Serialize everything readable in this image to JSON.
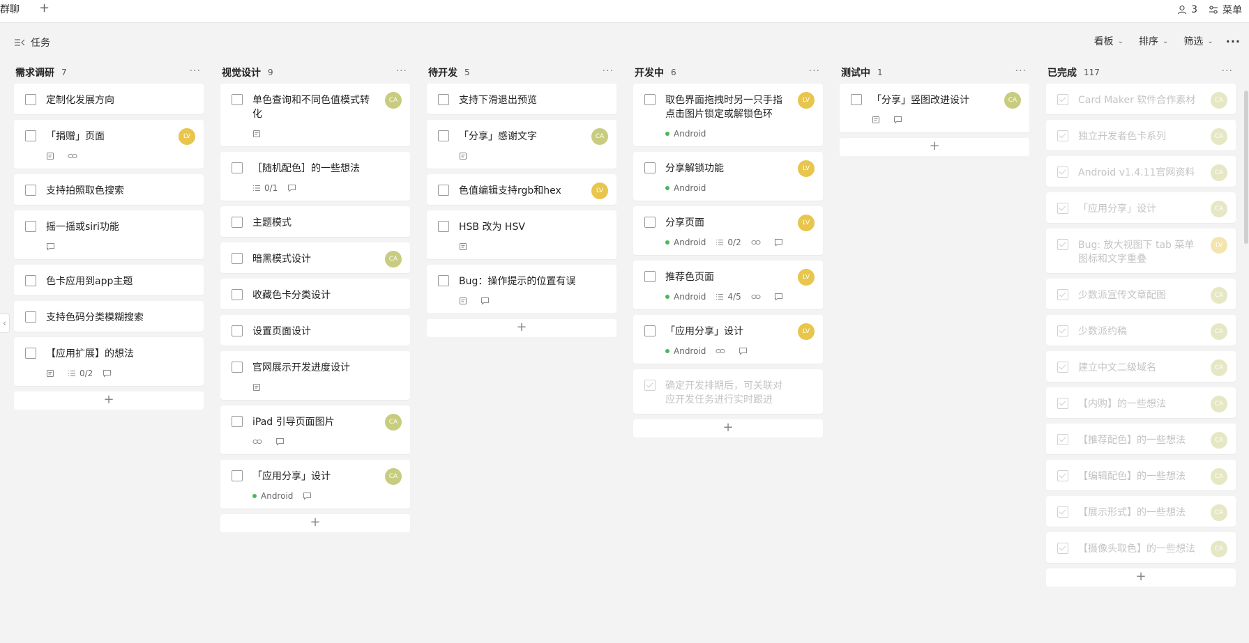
{
  "topbar": {
    "tab_title": "群聊",
    "add_tab": "+",
    "member_count": "3",
    "menu_label": "菜单"
  },
  "toolbar": {
    "title": "任务",
    "board": "看板",
    "sort": "排序",
    "filter": "筛选",
    "more": "···"
  },
  "columns": [
    {
      "title": "需求调研",
      "count": "7",
      "cards": [
        {
          "title": "定制化发展方向"
        },
        {
          "title": "「捐赠」页面",
          "avatar": "LV",
          "meta": [
            "doc",
            "link"
          ]
        },
        {
          "title": "支持拍照取色搜索"
        },
        {
          "title": "摇一摇或siri功能",
          "meta": [
            "comment"
          ]
        },
        {
          "title": "色卡应用到app主题"
        },
        {
          "title": "支持色码分类模糊搜索"
        },
        {
          "title": "【应用扩展】的想法",
          "checklist": "0/2",
          "meta": [
            "doc",
            "checklist",
            "comment"
          ]
        }
      ]
    },
    {
      "title": "视觉设计",
      "count": "9",
      "cards": [
        {
          "title": "单色查询和不同色值模式转化",
          "avatar": "CA",
          "meta": [
            "doc"
          ]
        },
        {
          "title": "［随机配色］的一些想法",
          "checklist": "0/1",
          "meta": [
            "checklist",
            "comment"
          ]
        },
        {
          "title": "主题模式"
        },
        {
          "title": "暗黑模式设计",
          "avatar": "CA"
        },
        {
          "title": "收藏色卡分类设计"
        },
        {
          "title": "设置页面设计"
        },
        {
          "title": "官网展示开发进度设计",
          "meta": [
            "doc"
          ]
        },
        {
          "title": "iPad 引导页面图片",
          "avatar": "CA",
          "meta": [
            "link",
            "comment"
          ]
        },
        {
          "title": "「应用分享」设计",
          "avatar": "CA",
          "tag": "Android",
          "meta": [
            "tag",
            "comment"
          ]
        }
      ]
    },
    {
      "title": "待开发",
      "count": "5",
      "cards": [
        {
          "title": "支持下滑退出预览"
        },
        {
          "title": "「分享」感谢文字",
          "avatar": "CA",
          "meta": [
            "doc"
          ]
        },
        {
          "title": "色值编辑支持rgb和hex",
          "avatar": "LV"
        },
        {
          "title": "HSB 改为 HSV",
          "meta": [
            "doc"
          ]
        },
        {
          "title": "Bug：操作提示的位置有误",
          "meta": [
            "doc",
            "comment"
          ]
        }
      ]
    },
    {
      "title": "开发中",
      "count": "6",
      "cards": [
        {
          "title": "取色界面拖拽时另一只手指点击图片锁定或解锁色环",
          "avatar": "LV",
          "tag": "Android",
          "meta": [
            "tag"
          ]
        },
        {
          "title": "分享解锁功能",
          "avatar": "LV",
          "tag": "Android",
          "meta": [
            "tag"
          ]
        },
        {
          "title": "分享页面",
          "avatar": "LV",
          "tag": "Android",
          "checklist": "0/2",
          "meta": [
            "tag",
            "checklist",
            "link",
            "comment"
          ]
        },
        {
          "title": "推荐色页面",
          "avatar": "LV",
          "tag": "Android",
          "checklist": "4/5",
          "meta": [
            "tag",
            "checklist",
            "link",
            "comment"
          ]
        },
        {
          "title": "「应用分享」设计",
          "avatar": "LV",
          "tag": "Android",
          "meta": [
            "tag",
            "link",
            "comment"
          ]
        },
        {
          "title": "确定开发排期后，可关联对应开发任务进行实时跟进",
          "done": true
        }
      ]
    },
    {
      "title": "测试中",
      "count": "1",
      "cards": [
        {
          "title": "「分享」竖图改进设计",
          "avatar": "CA",
          "meta": [
            "doc",
            "comment"
          ]
        }
      ]
    },
    {
      "title": "已完成",
      "count": "117",
      "cards": [
        {
          "title": "Card Maker 软件合作素材",
          "avatar": "CA",
          "done": true
        },
        {
          "title": "独立开发者色卡系列",
          "avatar": "CA",
          "done": true
        },
        {
          "title": "Android v1.4.11官网资料",
          "avatar": "CA",
          "done": true
        },
        {
          "title": "「应用分享」设计",
          "avatar": "CA",
          "done": true
        },
        {
          "title": "Bug: 放大视图下 tab 菜单图标和文字重叠",
          "avatar": "LV",
          "done": true
        },
        {
          "title": "少数派宣传文章配图",
          "avatar": "CA",
          "done": true
        },
        {
          "title": "少数派约稿",
          "avatar": "CA",
          "done": true
        },
        {
          "title": "建立中文二级域名",
          "avatar": "CA",
          "done": true
        },
        {
          "title": "【内购】的一些想法",
          "avatar": "CA",
          "done": true
        },
        {
          "title": "【推荐配色】的一些想法",
          "avatar": "CA",
          "done": true
        },
        {
          "title": "【编辑配色】的一些想法",
          "avatar": "CA",
          "done": true
        },
        {
          "title": "【展示形式】的一些想法",
          "avatar": "CA",
          "done": true
        },
        {
          "title": "【摄像头取色】的一些想法",
          "avatar": "CA",
          "done": true
        }
      ]
    }
  ],
  "add_label": "+",
  "colors": {
    "avatar_lv": "#e8c54c",
    "avatar_ca": "#c8cc7e",
    "android_dot": "#48b85a"
  }
}
